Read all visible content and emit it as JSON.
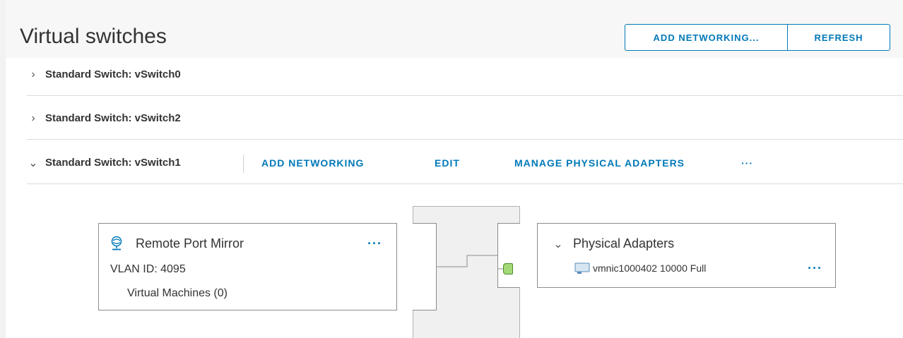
{
  "header": {
    "title": "Virtual switches",
    "add_networking_label": "ADD NETWORKING...",
    "refresh_label": "REFRESH"
  },
  "switches": [
    {
      "label": "Standard Switch: vSwitch0",
      "expanded": false
    },
    {
      "label": "Standard Switch: vSwitch2",
      "expanded": false
    },
    {
      "label": "Standard Switch: vSwitch1",
      "expanded": true
    }
  ],
  "switch_actions": {
    "add_networking": "ADD NETWORKING",
    "edit": "EDIT",
    "manage_physical_adapters": "MANAGE PHYSICAL ADAPTERS",
    "more": "···"
  },
  "port_group": {
    "name": "Remote Port Mirror",
    "vlan": "VLAN ID: 4095",
    "vms": "Virtual Machines (0)",
    "more": "···",
    "icon": "port-group-icon"
  },
  "physical_adapters": {
    "title": "Physical Adapters",
    "adapters": [
      {
        "label": "vmnic1000402 10000 Full",
        "icon": "nic-icon"
      }
    ],
    "more": "···"
  },
  "colors": {
    "accent": "#0079b8",
    "port_green": "#a3d977",
    "text": "#333333"
  }
}
